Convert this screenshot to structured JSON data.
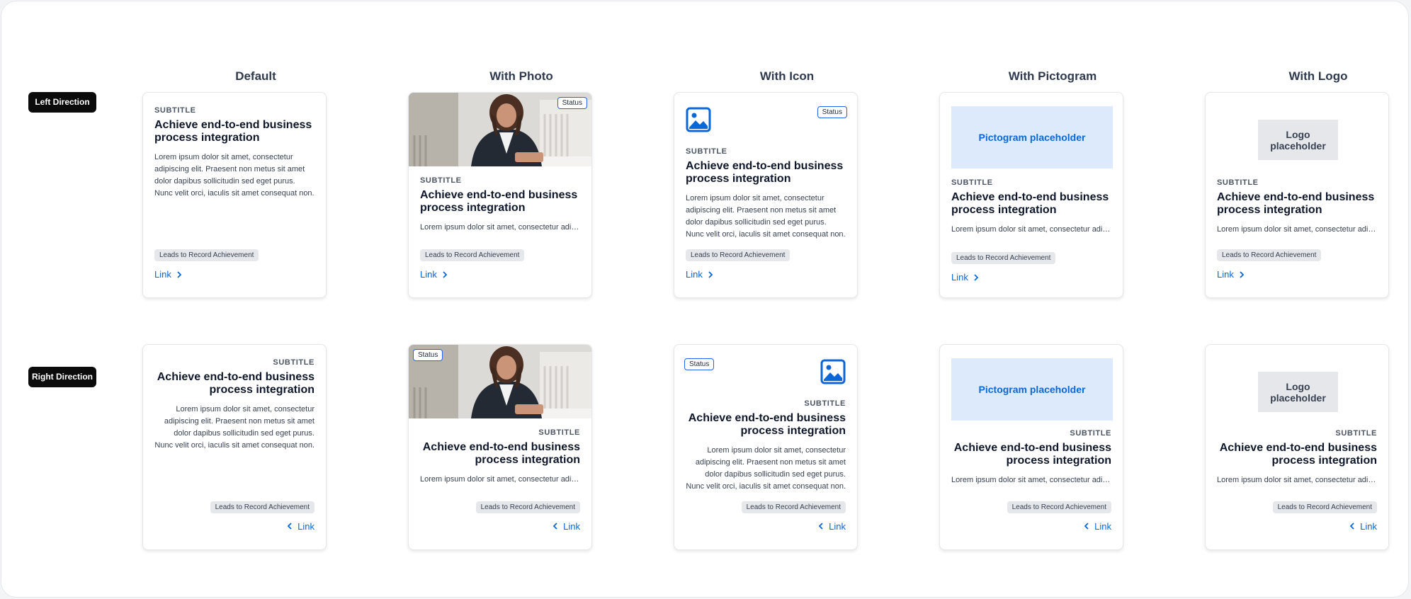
{
  "columns": [
    "Default",
    "With Photo",
    "With Icon",
    "With Pictogram",
    "With Logo"
  ],
  "rows": [
    "Left Direction",
    "Right Direction"
  ],
  "card": {
    "subtitle": "SUBTITLE",
    "title": "Achieve end-to-end business process integration",
    "body_full": "Lorem ipsum dolor sit amet, consectetur adipiscing elit. Praesent non metus sit amet dolor dapibus sollicitudin sed eget purus. Nunc velit orci, iaculis sit amet consequat non.",
    "body_short": "Lorem ipsum dolor sit amet, consectetur adipiscing elit.",
    "tag": "Leads to Record Achievement",
    "link": "Link",
    "status": "Status",
    "pictogram": "Pictogram placeholder",
    "logo": "Logo placeholder"
  },
  "icons": {
    "chevron_right": "chevron-right-icon",
    "chevron_left": "chevron-left-icon",
    "image": "image-icon"
  },
  "colors": {
    "accent": "#0b67d6",
    "status_border": "#2563eb",
    "pictogram_bg": "#ddeafb",
    "tag_bg": "#e5e7eb",
    "row_label_bg": "#0b0b0b",
    "header_text": "#2f3a4d"
  }
}
